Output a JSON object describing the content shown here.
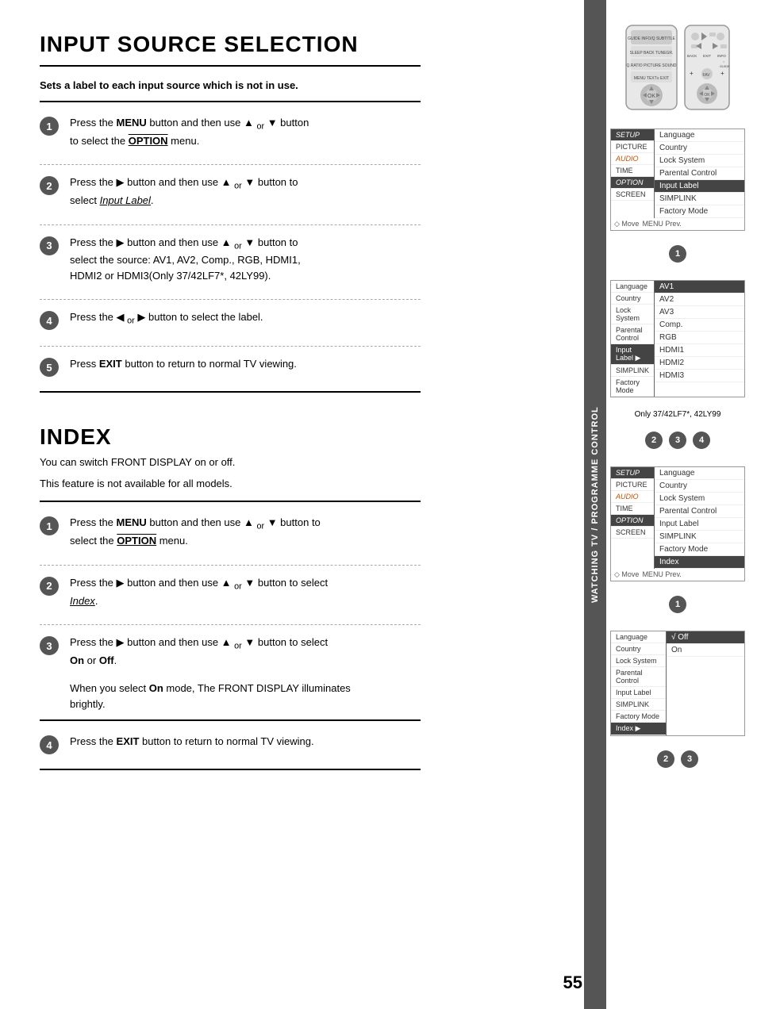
{
  "page": {
    "number": "55",
    "sidebar_label": "WATCHING TV / PROGRAMME CONTROL"
  },
  "input_source_section": {
    "title": "INPUT SOURCE SELECTION",
    "subtitle": "Sets a label to each input source which is not in use.",
    "steps": [
      {
        "num": "1",
        "text": "Press the MENU button and then use ▲ or ▼ button to select the OPTION menu."
      },
      {
        "num": "2",
        "text": "Press the ▶ button and then use ▲ or ▼ button to select Input Label."
      },
      {
        "num": "3",
        "text": "Press the ▶ button and then use ▲ or ▼ button to select the source: AV1, AV2, Comp., RGB, HDMI1, HDMI2 or HDMI3(Only 37/42LF7*, 42LY99)."
      },
      {
        "num": "4",
        "text": "Press the ◀ or ▶ button to select the label."
      },
      {
        "num": "5",
        "text": "Press EXIT button to return to normal TV viewing."
      }
    ]
  },
  "index_section": {
    "title": "INDEX",
    "intro_line1": "You can switch FRONT DISPLAY on or off.",
    "intro_line2": "This feature is not available for all models.",
    "steps": [
      {
        "num": "1",
        "text": "Press the MENU button and then use ▲ or ▼ button to select the OPTION menu."
      },
      {
        "num": "2",
        "text": "Press the ▶ button and then use ▲ or ▼ button to select Index."
      },
      {
        "num": "3",
        "text": "Press the ▶ button and then use ▲ or ▼ button to select On or Off.",
        "subnote": "When you select On mode, The FRONT DISPLAY illuminates brightly."
      },
      {
        "num": "4",
        "text": "Press the EXIT button to return to normal TV viewing."
      }
    ]
  },
  "menu_screens": {
    "screen1_left_items": [
      {
        "label": "SETUP",
        "type": "highlighted"
      },
      {
        "label": "PICTURE",
        "type": "normal"
      },
      {
        "label": "AUDIO",
        "type": "orange"
      },
      {
        "label": "TIME",
        "type": "normal"
      },
      {
        "label": "OPTION",
        "type": "highlighted"
      },
      {
        "label": "SCREEN",
        "type": "normal"
      }
    ],
    "screen1_right_items": [
      {
        "label": "Language"
      },
      {
        "label": "Country"
      },
      {
        "label": "Lock System"
      },
      {
        "label": "Parental Control"
      },
      {
        "label": "Input Label",
        "selected": true
      },
      {
        "label": "SIMPLINK"
      },
      {
        "label": "Factory Mode"
      }
    ],
    "screen2_left_items": [
      {
        "label": "Language"
      },
      {
        "label": "Country"
      },
      {
        "label": "Lock System"
      },
      {
        "label": "Parental Control"
      },
      {
        "label": "Input Label",
        "selected": true
      },
      {
        "label": "SIMPLINK"
      },
      {
        "label": "Factory Mode"
      }
    ],
    "screen2_right_items": [
      {
        "label": "AV1"
      },
      {
        "label": "AV2"
      },
      {
        "label": "AV3"
      },
      {
        "label": "Comp."
      },
      {
        "label": "RGB"
      },
      {
        "label": "HDMI1"
      },
      {
        "label": "HDMI2"
      },
      {
        "label": "HDMI3"
      }
    ],
    "screen3_left_items": [
      {
        "label": "SETUP",
        "type": "highlighted"
      },
      {
        "label": "PICTURE",
        "type": "normal"
      },
      {
        "label": "AUDIO",
        "type": "orange"
      },
      {
        "label": "TIME",
        "type": "normal"
      },
      {
        "label": "OPTION",
        "type": "highlighted"
      },
      {
        "label": "SCREEN",
        "type": "normal"
      }
    ],
    "screen3_right_items": [
      {
        "label": "Language"
      },
      {
        "label": "Country"
      },
      {
        "label": "Lock System"
      },
      {
        "label": "Parental Control"
      },
      {
        "label": "Input Label"
      },
      {
        "label": "SIMPLINK"
      },
      {
        "label": "Factory Mode"
      },
      {
        "label": "Index",
        "selected": true
      }
    ],
    "screen4_left_items": [
      {
        "label": "Language"
      },
      {
        "label": "Country"
      },
      {
        "label": "Lock System"
      },
      {
        "label": "Parental Control"
      },
      {
        "label": "Input Label"
      },
      {
        "label": "SIMPLINK"
      },
      {
        "label": "Factory Mode"
      },
      {
        "label": "Index",
        "selected": true
      }
    ],
    "screen4_right_items": [
      {
        "label": "√ Off",
        "selected": true
      },
      {
        "label": "On"
      }
    ],
    "only_note": "Only 37/42LF7*, 42LY99",
    "move_prev_label": "Move MENU Prev."
  }
}
